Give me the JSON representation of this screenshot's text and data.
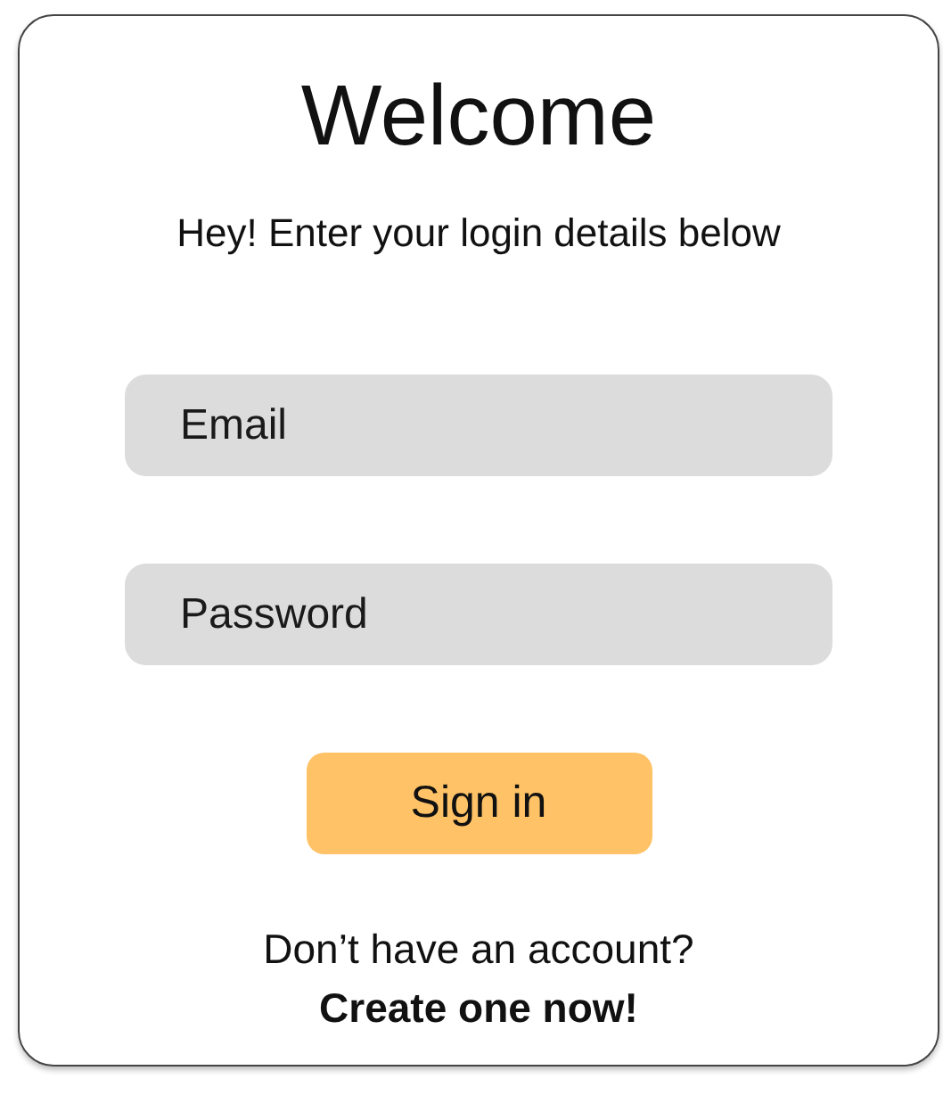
{
  "title": "Welcome",
  "subtitle": "Hey! Enter your login details below",
  "fields": [
    {
      "placeholder": "Email"
    },
    {
      "placeholder": "Password"
    }
  ],
  "button": "Sign in",
  "prompt": "Don’t have an account?",
  "link": "Create one now!"
}
